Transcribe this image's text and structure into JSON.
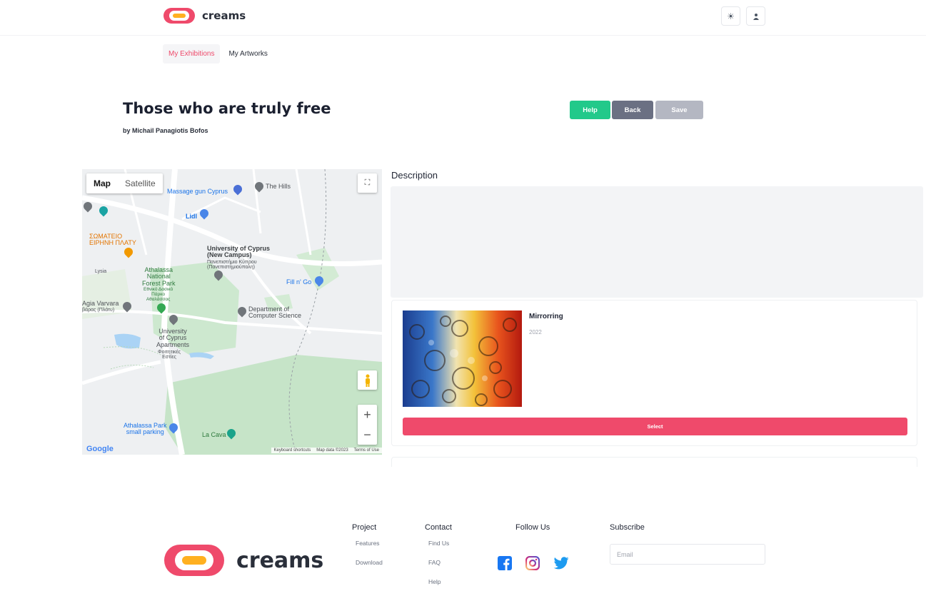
{
  "brand": {
    "name": "creams",
    "primary": "#ef4a6b",
    "accent": "#ffb020"
  },
  "header": {
    "theme_icon": "sun-icon",
    "profile_icon": "user-icon"
  },
  "tabs": [
    {
      "label": "My Exhibitions",
      "active": true
    },
    {
      "label": "My Artworks",
      "active": false
    }
  ],
  "exhibition": {
    "title": "Those who are truly free",
    "byline": "by Michail Panagiotis Bofos"
  },
  "actions": {
    "help": "Help",
    "back": "Back",
    "save": "Save",
    "help_color": "#22c98a",
    "back_color": "#6b7083",
    "save_color": "#b4b7c2"
  },
  "map": {
    "toggle_map": "Map",
    "toggle_satellite": "Satellite",
    "labels": {
      "massage": "Massage gun Cyprus",
      "the_hills": "The Hills",
      "lidl": "Lidl",
      "somateio": "ΣΩΜΑΤΕΙΟ\nΕΙΡΗΝΗ ΠΛΑΤΥ",
      "ucy": "University of Cyprus\n(New Campus)",
      "ucy_gr": "Πανεπιστήμιο Κύπρου\n(Πανεπιστημιούπολη)",
      "athalassa": "Athalassa\nNational\nForest Park",
      "athalassa_gr": "Εθνικό Δασικό\nΠάρκο\nΑθαλάσσας",
      "fill_n_go": "Fill n' Go",
      "agia_varvara": "Agia Varvara",
      "agia_varvara_gr": "βάρας (Πλάτυ)",
      "dept_cs": "Department of\nComputer Science",
      "ucy_apts": "University\nof Cyprus\nApartments",
      "ucy_apts_gr": "Φοιτητικές\nΕστίες",
      "parking": "Athalassa Park\nsmall parking",
      "la_cava": "La Cava",
      "lysia": "Lysia"
    },
    "google": "Google",
    "attribution": [
      "Keyboard shortcuts",
      "Map data ©2023",
      "Terms of Use"
    ]
  },
  "description": {
    "heading": "Description",
    "text": ""
  },
  "artworks": [
    {
      "title": "Mirrorring",
      "year": "2022",
      "select_label": "Select"
    }
  ],
  "footer": {
    "columns": [
      {
        "heading": "Project",
        "links": [
          "Features",
          "Download"
        ]
      },
      {
        "heading": "Contact",
        "links": [
          "Find Us",
          "FAQ",
          "Help"
        ]
      },
      {
        "heading": "Follow Us",
        "icons": [
          "facebook-icon",
          "instagram-icon",
          "twitter-icon"
        ]
      },
      {
        "heading": "Subscribe",
        "email_placeholder": "Email"
      }
    ]
  }
}
